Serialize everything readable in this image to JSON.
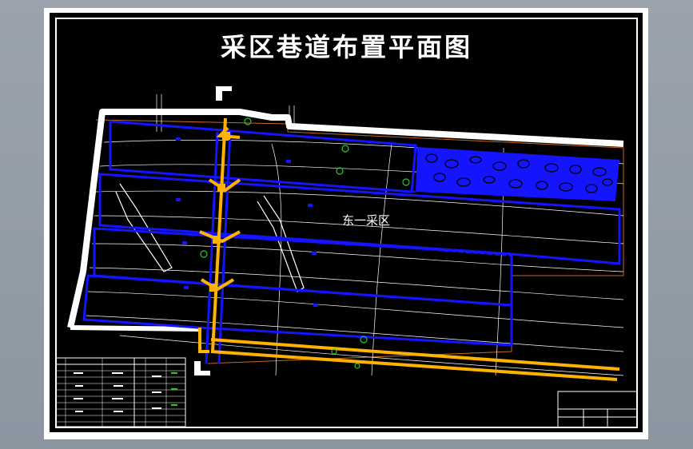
{
  "drawing": {
    "title": "采区巷道布置平面图",
    "area_label": "东一采区"
  },
  "colors": {
    "background": "#000000",
    "frame": "#ffffff",
    "roadway_blue": "#1414ff",
    "haulage_yellow": "#ffb300",
    "contour_white": "#ffffff",
    "boundary_orange": "#c8651e",
    "annotation_green": "#22cc22"
  }
}
